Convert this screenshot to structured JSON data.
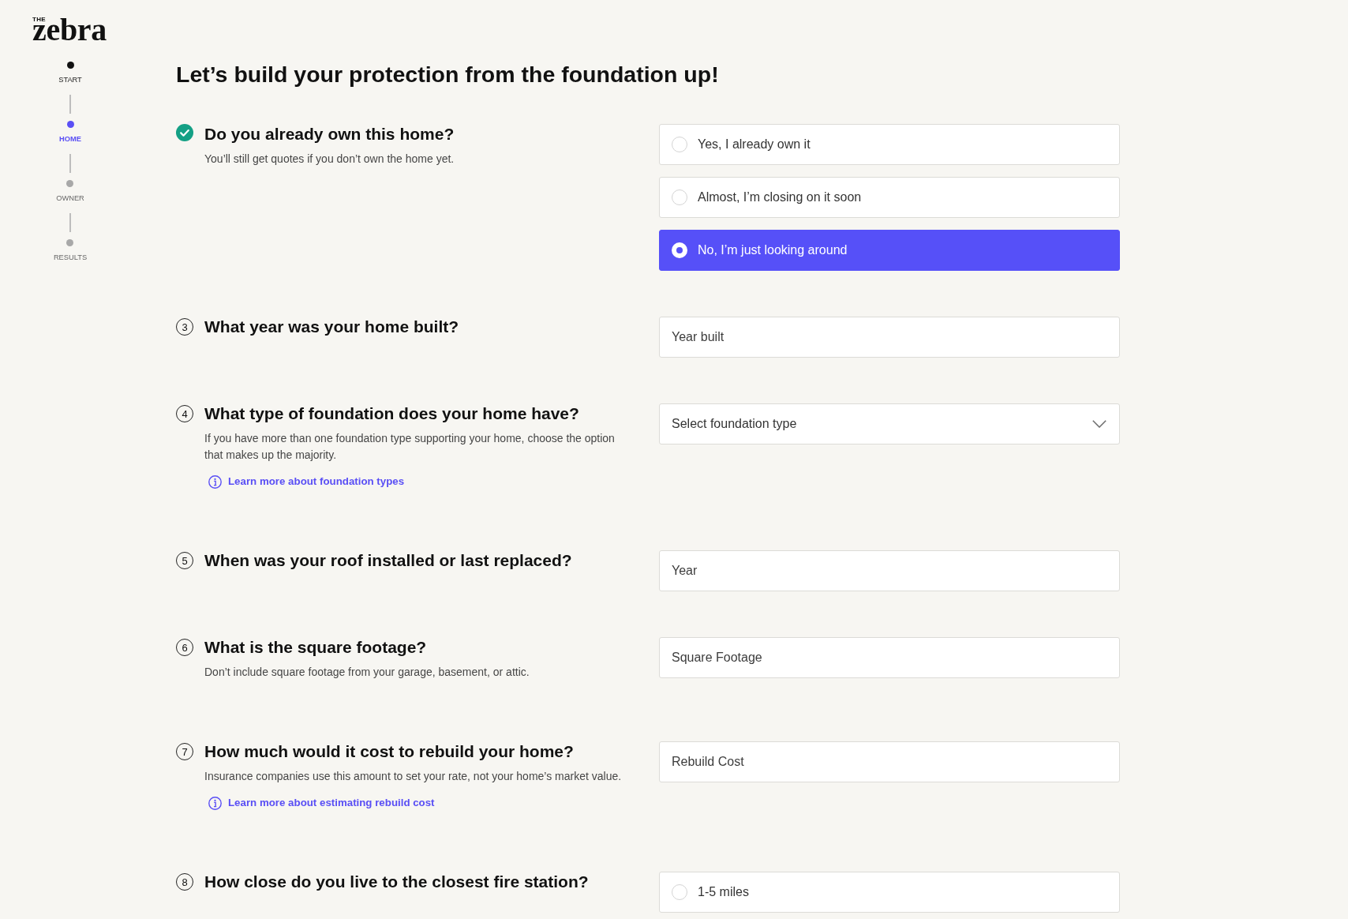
{
  "logo": {
    "prefix": "THE",
    "name": "zebra"
  },
  "steps": [
    {
      "label": "START",
      "completed": true,
      "selected": false
    },
    {
      "label": "HOME",
      "completed": false,
      "selected": true
    },
    {
      "label": "OWNER",
      "completed": false,
      "selected": false
    },
    {
      "label": "RESULTS",
      "completed": false,
      "selected": false
    }
  ],
  "heading": "Let’s build your protection from the foundation up!",
  "questions": [
    {
      "answered": true,
      "title": "Do you already own this home?",
      "description": "You’ll still get quotes if you don’t own the home yet.",
      "field": {
        "kind": "radio",
        "options": [
          {
            "label": "Yes, I already own it",
            "selected": false
          },
          {
            "label": "Almost, I’m closing on it soon",
            "selected": false
          },
          {
            "label": "No, I’m just looking around",
            "selected": true
          }
        ]
      }
    },
    {
      "answered": false,
      "number": "3",
      "title": "What year was your home built?",
      "field": {
        "kind": "text",
        "placeholder": "Year built"
      }
    },
    {
      "answered": false,
      "number": "4",
      "title": "What type of foundation does your home have?",
      "description": "If you have more than one foundation type supporting your home, choose the option that makes up the majority.",
      "link": "Learn more about foundation types",
      "field": {
        "kind": "select",
        "placeholder": "Select foundation type"
      }
    },
    {
      "answered": false,
      "number": "5",
      "title": "When was your roof installed or last replaced?",
      "field": {
        "kind": "text",
        "placeholder": "Year"
      }
    },
    {
      "answered": false,
      "number": "6",
      "title": "What is the square footage?",
      "description": "Don’t include square footage from your garage, basement, or attic.",
      "field": {
        "kind": "text",
        "placeholder": "Square Footage"
      }
    },
    {
      "answered": false,
      "number": "7",
      "title": "How much would it cost to rebuild your home?",
      "description": "Insurance companies use this amount to set your rate, not your home’s market value.",
      "link": "Learn more about estimating rebuild cost",
      "field": {
        "kind": "text",
        "placeholder": "Rebuild Cost"
      }
    },
    {
      "answered": false,
      "number": "8",
      "title": "How close do you live to the closest fire station?",
      "field": {
        "kind": "radio",
        "options": [
          {
            "label": "1-5 miles",
            "selected": false
          }
        ]
      }
    }
  ]
}
